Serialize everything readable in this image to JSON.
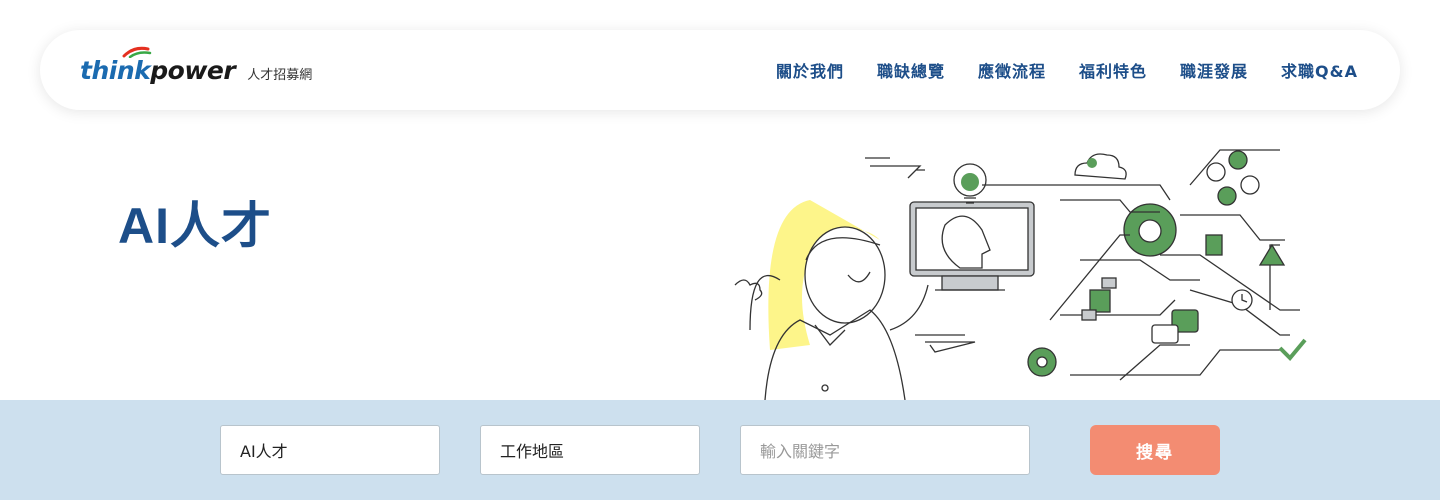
{
  "header": {
    "logo": {
      "word_think": "think",
      "word_power": "power",
      "subtitle": "人才招募網"
    },
    "nav": [
      "關於我們",
      "職缺總覽",
      "應徵流程",
      "福利特色",
      "職涯發展",
      "求職Q&A"
    ]
  },
  "hero": {
    "title": "AI人才"
  },
  "search": {
    "category_value": "AI人才",
    "location_value": "工作地區",
    "keyword_placeholder": "輸入關鍵字",
    "button_label": "搜尋"
  },
  "colors": {
    "brand_blue": "#1d4e89",
    "search_bg": "#cde0ee",
    "button": "#f38c72",
    "accent_green": "#5a9e5a",
    "accent_yellow": "#fdf58a"
  }
}
